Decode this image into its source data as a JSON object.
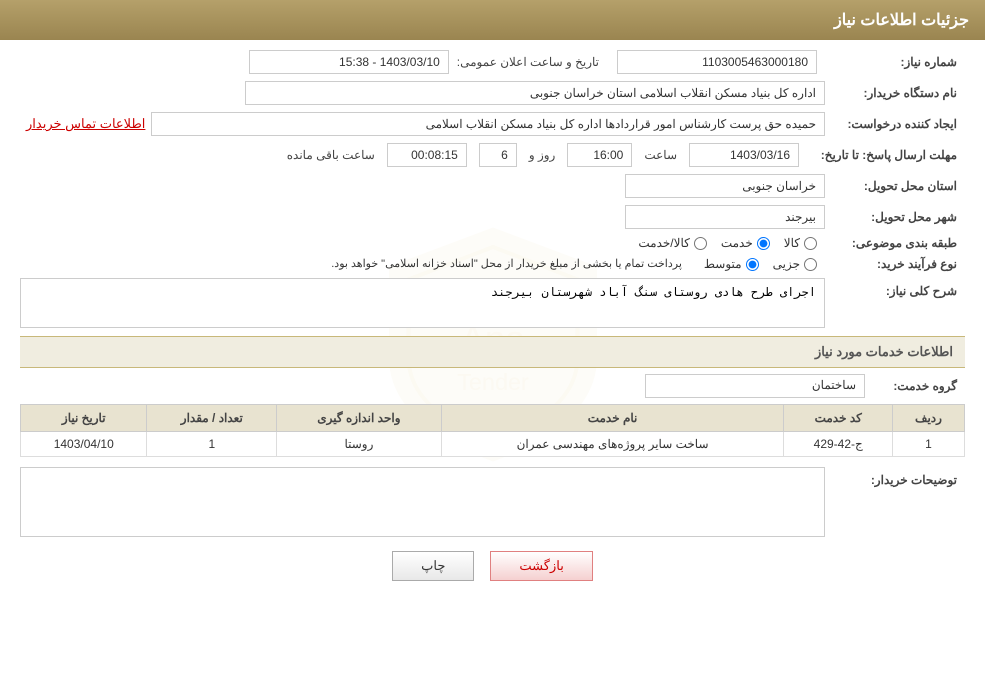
{
  "header": {
    "title": "جزئیات اطلاعات نیاز"
  },
  "fields": {
    "need_number_label": "شماره نیاز:",
    "need_number_value": "1103005463000180",
    "announcement_label": "تاریخ و ساعت اعلان عمومی:",
    "announcement_value": "1403/03/10 - 15:38",
    "buyer_org_label": "نام دستگاه خریدار:",
    "buyer_org_value": "اداره کل بنیاد مسکن انقلاب اسلامی استان خراسان جنوبی",
    "creator_label": "ایجاد کننده درخواست:",
    "creator_value": "حمیده حق پرست کارشناس امور قراردادها اداره کل بنیاد مسکن انقلاب اسلامی",
    "contact_link_text": "اطلاعات تماس خریدار",
    "deadline_label": "مهلت ارسال پاسخ: تا تاریخ:",
    "deadline_date": "1403/03/16",
    "deadline_time_label": "ساعت",
    "deadline_time": "16:00",
    "deadline_day_label": "روز و",
    "deadline_day": "6",
    "deadline_hms_label": "ساعت باقی مانده",
    "deadline_hms": "00:08:15",
    "province_label": "استان محل تحویل:",
    "province_value": "خراسان جنوبی",
    "city_label": "شهر محل تحویل:",
    "city_value": "بیرجند",
    "category_label": "طبقه بندی موضوعی:",
    "category_options": [
      "کالا",
      "خدمت",
      "کالا/خدمت"
    ],
    "category_selected": "خدمت",
    "process_label": "نوع فرآیند خرید:",
    "process_options": [
      "جزیی",
      "متوسط"
    ],
    "process_selected": "متوسط",
    "process_note": "پرداخت تمام یا بخشی از مبلغ خریدار از محل \"اسناد خزانه اسلامی\" خواهد بود.",
    "description_section_label": "شرح کلی نیاز:",
    "description_value": "اجرای طرح هادی روستای سنگ آباد شهرستان بیرجند",
    "services_section_title": "اطلاعات خدمات مورد نیاز",
    "service_group_label": "گروه خدمت:",
    "service_group_value": "ساختمان",
    "table_headers": [
      "ردیف",
      "کد خدمت",
      "نام خدمت",
      "واحد اندازه گیری",
      "تعداد / مقدار",
      "تاریخ نیاز"
    ],
    "table_rows": [
      {
        "row": "1",
        "code": "ج-42-429",
        "name": "ساخت سایر پروژه‌های مهندسی عمران",
        "unit": "روستا",
        "qty": "1",
        "date": "1403/04/10"
      }
    ],
    "buyer_notes_label": "توضیحات خریدار:",
    "buyer_notes_value": "",
    "btn_print": "چاپ",
    "btn_back": "بازگشت"
  }
}
